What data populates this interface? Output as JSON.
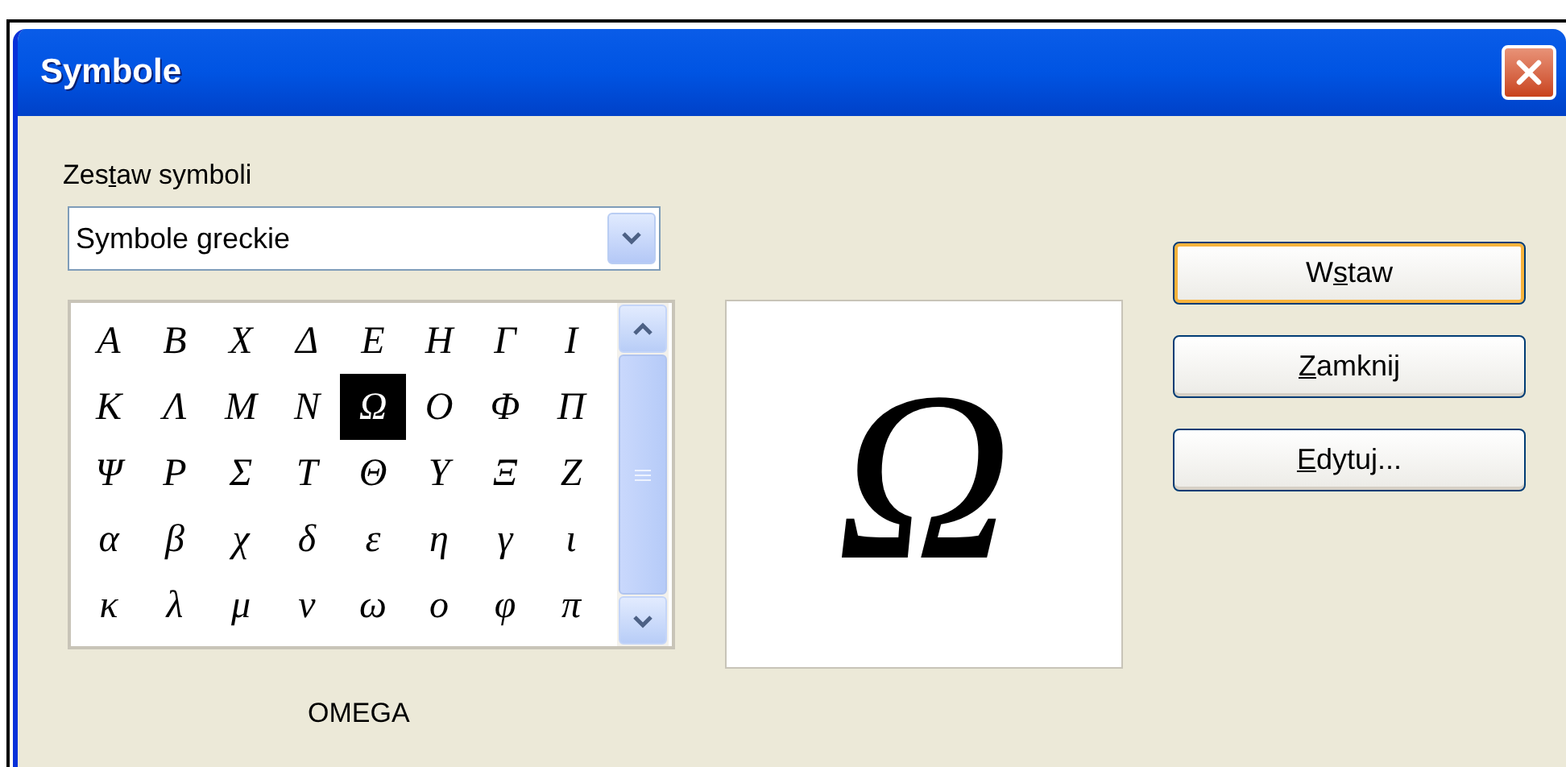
{
  "window": {
    "title": "Symbole"
  },
  "symbol_set": {
    "label": {
      "before": "Zes",
      "accel": "t",
      "after": "aw symboli"
    },
    "value": "Symbole greckie"
  },
  "symbols": [
    {
      "char": "Α",
      "selected": false
    },
    {
      "char": "Β",
      "selected": false
    },
    {
      "char": "Χ",
      "selected": false
    },
    {
      "char": "Δ",
      "selected": false
    },
    {
      "char": "Ε",
      "selected": false
    },
    {
      "char": "Η",
      "selected": false
    },
    {
      "char": "Γ",
      "selected": false
    },
    {
      "char": "Ι",
      "selected": false
    },
    {
      "char": "Κ",
      "selected": false
    },
    {
      "char": "Λ",
      "selected": false
    },
    {
      "char": "Μ",
      "selected": false
    },
    {
      "char": "Ν",
      "selected": false
    },
    {
      "char": "Ω",
      "selected": true
    },
    {
      "char": "Ο",
      "selected": false
    },
    {
      "char": "Φ",
      "selected": false
    },
    {
      "char": "Π",
      "selected": false
    },
    {
      "char": "Ψ",
      "selected": false
    },
    {
      "char": "Ρ",
      "selected": false
    },
    {
      "char": "Σ",
      "selected": false
    },
    {
      "char": "Τ",
      "selected": false
    },
    {
      "char": "Θ",
      "selected": false
    },
    {
      "char": "Υ",
      "selected": false
    },
    {
      "char": "Ξ",
      "selected": false
    },
    {
      "char": "Ζ",
      "selected": false
    },
    {
      "char": "α",
      "selected": false
    },
    {
      "char": "β",
      "selected": false
    },
    {
      "char": "χ",
      "selected": false
    },
    {
      "char": "δ",
      "selected": false
    },
    {
      "char": "ε",
      "selected": false
    },
    {
      "char": "η",
      "selected": false
    },
    {
      "char": "γ",
      "selected": false
    },
    {
      "char": "ι",
      "selected": false
    },
    {
      "char": "κ",
      "selected": false
    },
    {
      "char": "λ",
      "selected": false
    },
    {
      "char": "μ",
      "selected": false
    },
    {
      "char": "ν",
      "selected": false
    },
    {
      "char": "ω",
      "selected": false
    },
    {
      "char": "ο",
      "selected": false
    },
    {
      "char": "φ",
      "selected": false
    },
    {
      "char": "π",
      "selected": false
    }
  ],
  "preview": {
    "char": "Ω"
  },
  "symbol_name": "OMEGA",
  "buttons": [
    {
      "label": {
        "before": "W",
        "accel": "s",
        "after": "taw"
      },
      "default": true
    },
    {
      "label": {
        "accel": "Z",
        "after": "amknij"
      },
      "default": false
    },
    {
      "label": {
        "accel": "E",
        "after": "dytuj..."
      },
      "default": false
    }
  ]
}
